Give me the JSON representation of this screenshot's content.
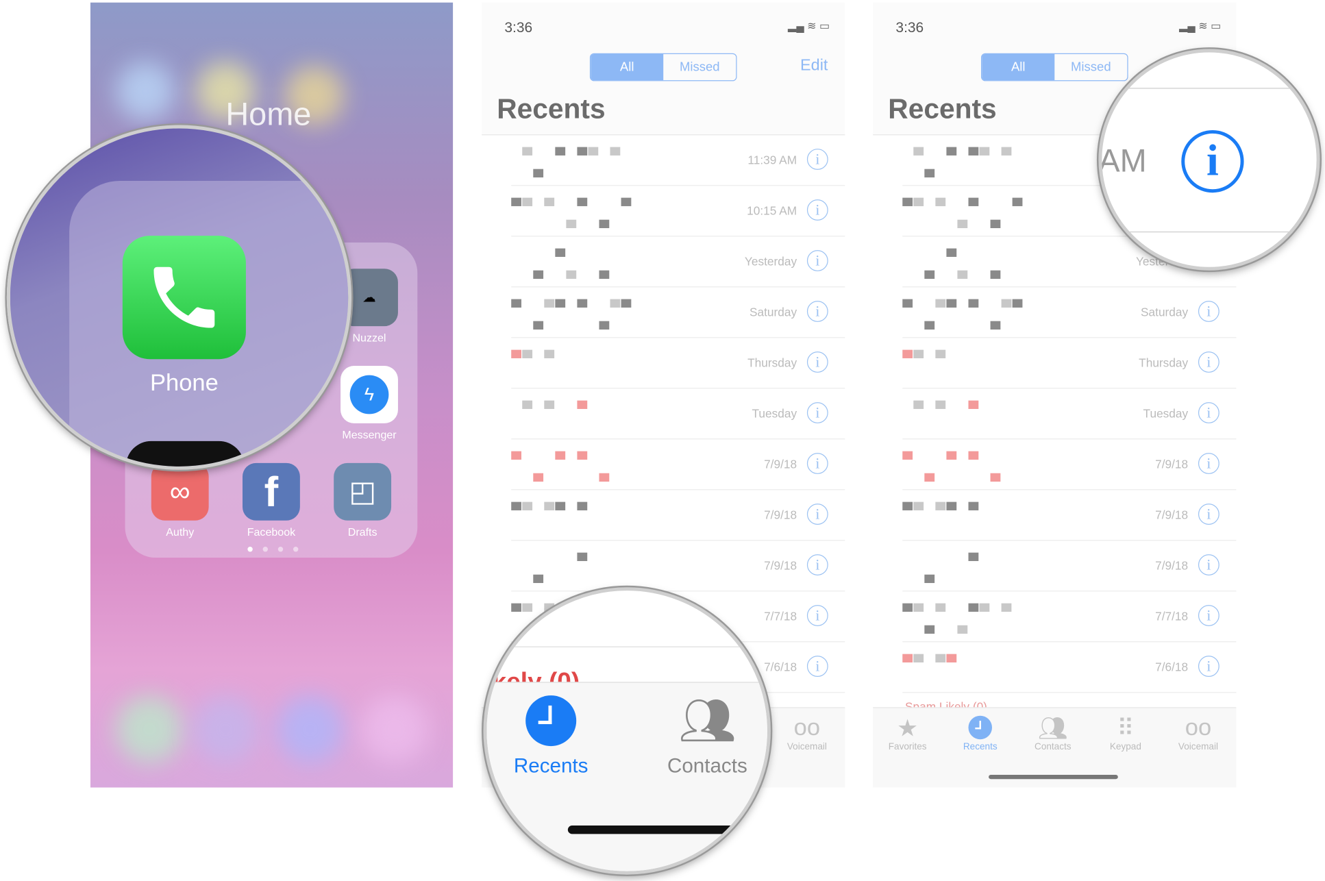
{
  "home_screen": {
    "folder_title": "Home",
    "apps": [
      {
        "name": "Nuzzel",
        "label": "Nuzzel"
      },
      {
        "name": "Messenger",
        "label": "Messenger"
      },
      {
        "name": "Authy",
        "label": "Authy"
      },
      {
        "name": "Facebook",
        "label": "Facebook"
      },
      {
        "name": "Drafts",
        "label": "Drafts"
      }
    ],
    "magnified_app": {
      "label": "Phone",
      "color": "#34c759"
    },
    "page_dots": 4
  },
  "recents_screen": {
    "status_time": "3:36",
    "segments": [
      {
        "label": "All",
        "selected": true
      },
      {
        "label": "Missed",
        "selected": false
      }
    ],
    "edit_label": "Edit",
    "title": "Recents",
    "rows": [
      {
        "when": "11:39 AM"
      },
      {
        "when": "10:15 AM"
      },
      {
        "when": "Yesterday"
      },
      {
        "when": "Saturday"
      },
      {
        "when": "Thursday"
      },
      {
        "when": "Tuesday"
      },
      {
        "when": "7/9/18"
      },
      {
        "when": "7/9/18"
      },
      {
        "when": "7/9/18"
      },
      {
        "when": "7/7/18"
      },
      {
        "when": "7/6/18"
      }
    ],
    "spam_label": "Spam Likely (0)",
    "tabs": [
      {
        "label": "Favorites",
        "icon": "star-icon"
      },
      {
        "label": "Recents",
        "icon": "clock-icon",
        "active": true
      },
      {
        "label": "Contacts",
        "icon": "contacts-icon"
      },
      {
        "label": "Keypad",
        "icon": "keypad-icon"
      },
      {
        "label": "Voicemail",
        "icon": "voicemail-icon"
      }
    ],
    "magnified_tabs": {
      "recents": "Recents",
      "contacts": "Contacts",
      "partial_text": "Likely (0)"
    },
    "magnified_info": {
      "partial_time": "AM"
    },
    "accent": "#1a7cf5"
  }
}
